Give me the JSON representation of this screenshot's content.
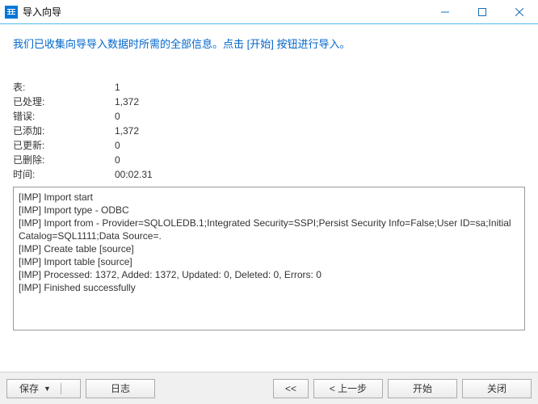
{
  "titlebar": {
    "title": "导入向导"
  },
  "header": {
    "text": "我们已收集向导导入数据时所需的全部信息。点击 [开始] 按钮进行导入。"
  },
  "stats": {
    "rows": [
      {
        "label": "表:",
        "value": "1"
      },
      {
        "label": "已处理:",
        "value": "1,372"
      },
      {
        "label": "错误:",
        "value": "0"
      },
      {
        "label": "已添加:",
        "value": "1,372"
      },
      {
        "label": "已更新:",
        "value": "0"
      },
      {
        "label": "已删除:",
        "value": "0"
      },
      {
        "label": "时间:",
        "value": "00:02.31"
      }
    ]
  },
  "log": {
    "lines": [
      "[IMP] Import start",
      "[IMP] Import type - ODBC",
      "[IMP] Import from - Provider=SQLOLEDB.1;Integrated Security=SSPI;Persist Security Info=False;User ID=sa;Initial Catalog=SQL1111;Data Source=.",
      "[IMP] Create table [source]",
      "[IMP] Import table [source]",
      "[IMP] Processed: 1372, Added: 1372, Updated: 0, Deleted: 0, Errors: 0",
      "[IMP] Finished successfully"
    ]
  },
  "buttons": {
    "save": "保存",
    "log": "日志",
    "back_double": "<<",
    "back": "< 上一步",
    "start": "开始",
    "close": "关闭"
  }
}
